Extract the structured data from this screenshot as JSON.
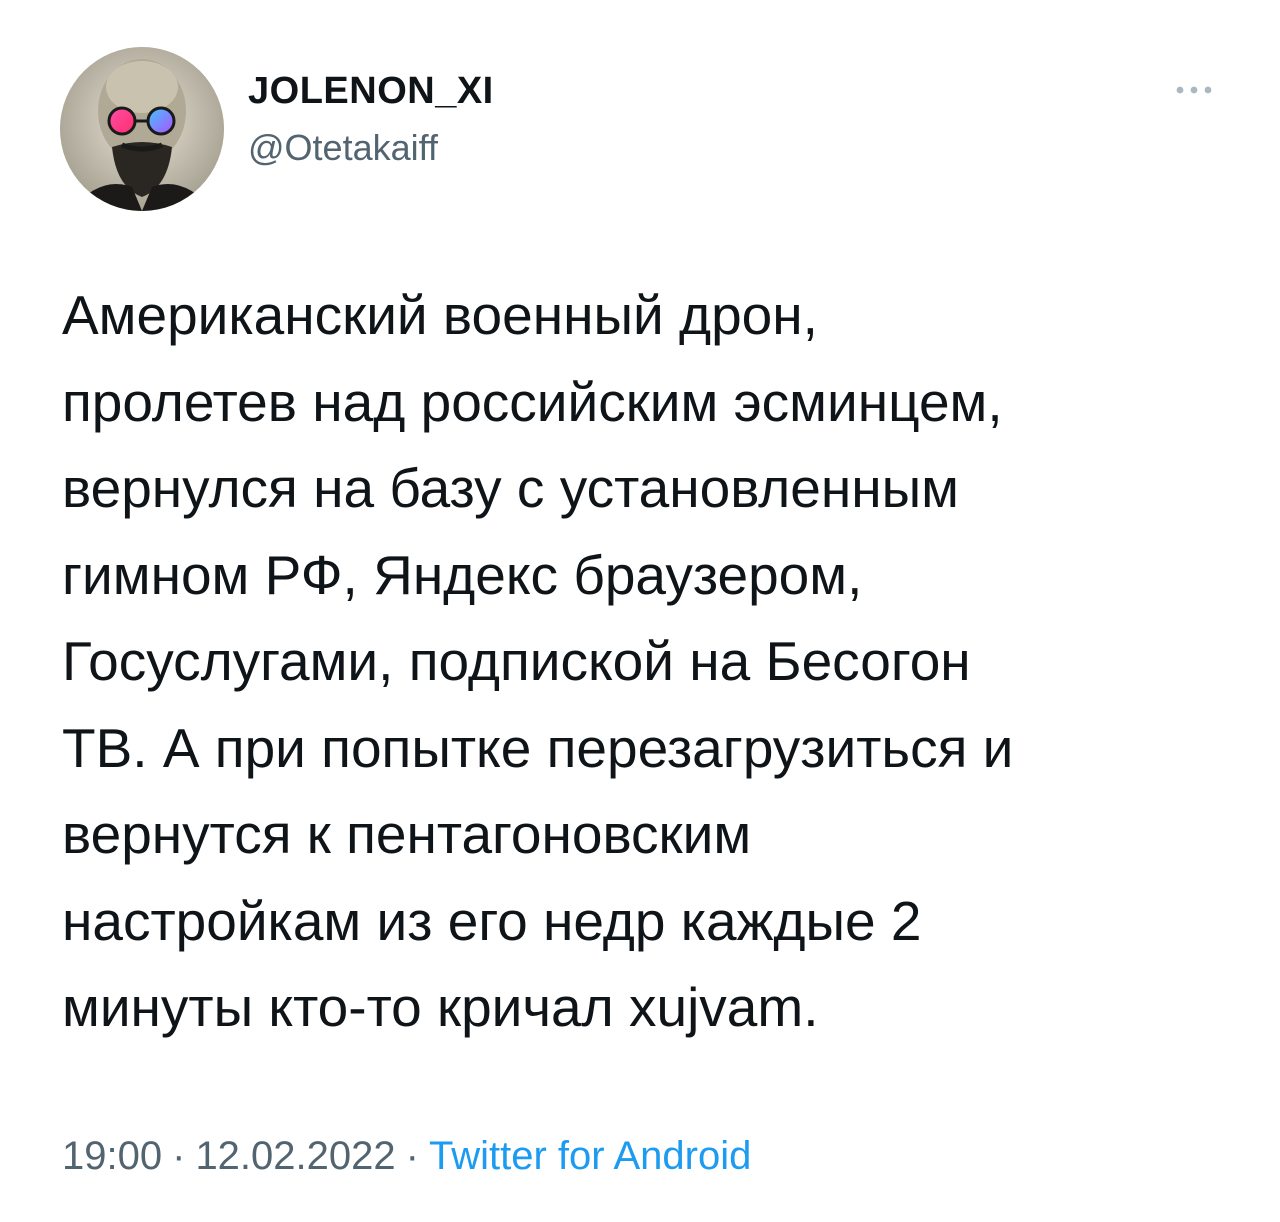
{
  "author": {
    "display_name": "JOLENON_XI",
    "handle": "@Otetakaiff",
    "avatar_icon": "user-avatar-icon"
  },
  "more_icon": "more-dots-icon",
  "tweet": {
    "text": "Американский военный дрон,\nпролетев над российским эсминцем,\nвернулся на базу с установленным\nгимном РФ, Яндекс браузером,\nГосуслугами, подпиской на Бесогон\nТВ. А при попытке перезагрузиться и\nвернутся к пентагоновским\nнастройкам из его недр каждые 2\nминуты кто-то кричал xujvam."
  },
  "meta": {
    "time": "19:00",
    "separator": "·",
    "date": "12.02.2022",
    "source": "Twitter for Android"
  },
  "colors": {
    "text": "#0f1419",
    "secondary": "#536471",
    "link": "#1d9bf0"
  }
}
